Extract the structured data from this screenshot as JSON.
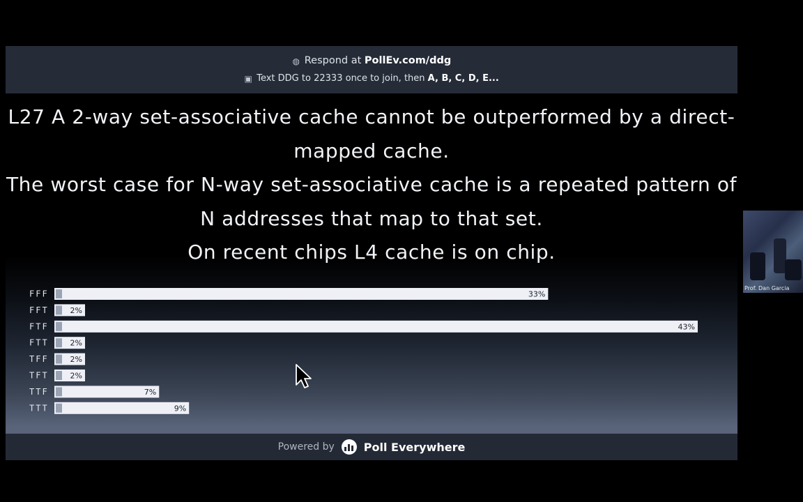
{
  "header": {
    "respond_prefix": "Respond at",
    "respond_url": "PollEv.com/ddg",
    "text_prefix": "Text",
    "text_code": "DDG",
    "text_to": "to",
    "text_number": "22333",
    "text_suffix": "once to join, then",
    "text_options": "A, B, C, D, E..."
  },
  "question": {
    "lines": [
      "L27 A 2-way set-associative cache cannot be outperformed by a direct-",
      "mapped cache.",
      "The worst case for N-way set-associative cache is a repeated pattern of",
      "N addresses that map to that set.",
      "On recent chips L4 cache is on chip."
    ]
  },
  "chart_data": {
    "type": "bar",
    "orientation": "horizontal",
    "categories": [
      "FFF",
      "FFT",
      "FTF",
      "FTT",
      "TFF",
      "TFT",
      "TTF",
      "TTT"
    ],
    "values": [
      33,
      2,
      43,
      2,
      2,
      2,
      7,
      9
    ],
    "value_labels": [
      "33%",
      "2%",
      "43%",
      "2%",
      "2%",
      "2%",
      "7%",
      "9%"
    ],
    "unit": "%",
    "bar_color": "#eef0f6",
    "label_color": "#1a1f2a"
  },
  "footer": {
    "powered_label": "Powered by",
    "brand": "Poll Everywhere"
  },
  "webcam": {
    "label": "Prof. Dan Garcia"
  },
  "colors": {
    "topbar": "#252c38",
    "footer": "#242a35",
    "background": "#000000"
  }
}
